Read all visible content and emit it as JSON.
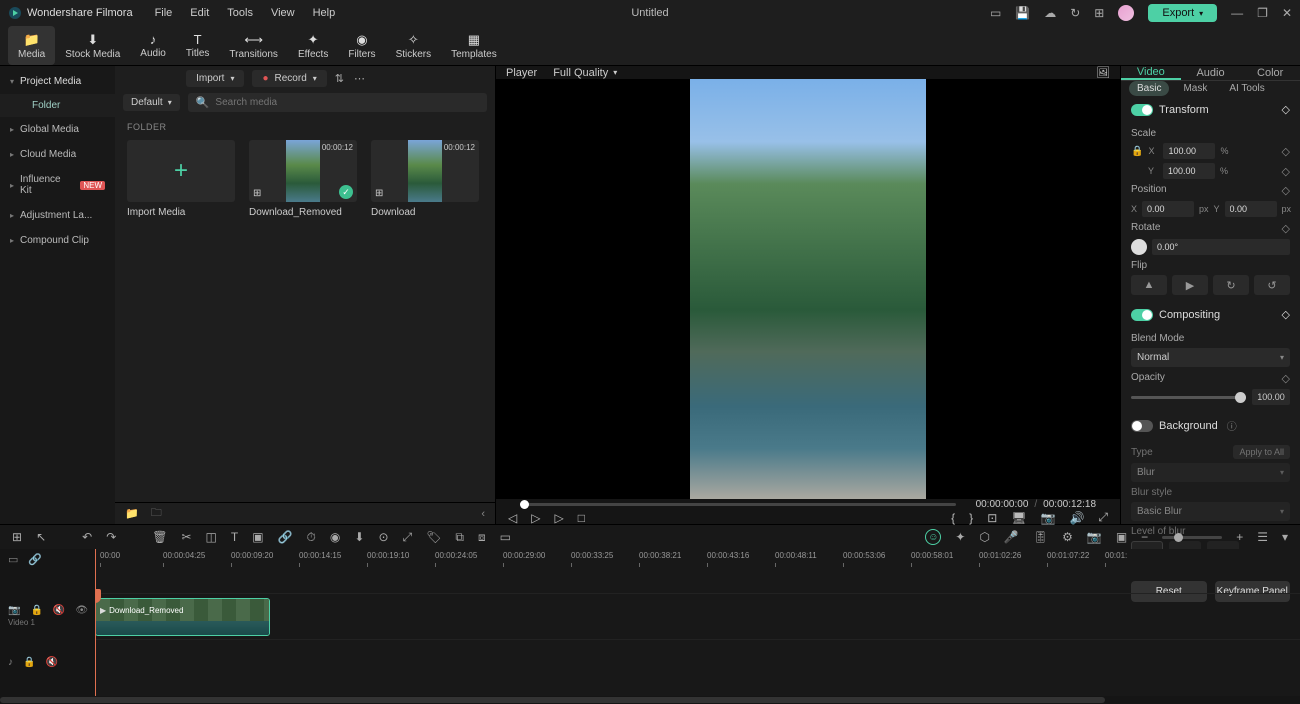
{
  "app": {
    "name": "Wondershare Filmora",
    "doc": "Untitled"
  },
  "menu": [
    "File",
    "Edit",
    "Tools",
    "View",
    "Help"
  ],
  "export": "Export",
  "ribbon": [
    {
      "label": "Media",
      "active": true
    },
    {
      "label": "Stock Media"
    },
    {
      "label": "Audio"
    },
    {
      "label": "Titles"
    },
    {
      "label": "Transitions"
    },
    {
      "label": "Effects"
    },
    {
      "label": "Filters"
    },
    {
      "label": "Stickers"
    },
    {
      "label": "Templates"
    }
  ],
  "leftTop": {
    "import": "Import",
    "record": "Record"
  },
  "sidebar": {
    "project": "Project Media",
    "folder": "Folder",
    "items": [
      {
        "label": "Global Media"
      },
      {
        "label": "Cloud Media"
      },
      {
        "label": "Influence Kit",
        "badge": "NEW"
      },
      {
        "label": "Adjustment La..."
      },
      {
        "label": "Compound Clip"
      }
    ]
  },
  "content": {
    "default": "Default",
    "searchPlaceholder": "Search media",
    "folderLabel": "FOLDER",
    "media": [
      {
        "name": "Import Media",
        "kind": "import"
      },
      {
        "name": "Download_Removed",
        "duration": "00:00:12",
        "checked": true
      },
      {
        "name": "Download",
        "duration": "00:00:12"
      }
    ]
  },
  "player": {
    "label": "Player",
    "quality": "Full Quality",
    "current": "00:00:00:00",
    "total": "00:00:12:18"
  },
  "right": {
    "tabs": [
      "Video",
      "Audio",
      "Color"
    ],
    "subtabs": [
      "Basic",
      "Mask",
      "AI Tools"
    ],
    "transform": "Transform",
    "scale": "Scale",
    "scaleX": "100.00",
    "scaleY": "100.00",
    "position": "Position",
    "posX": "0.00",
    "posY": "0.00",
    "rotate": "Rotate",
    "rotateVal": "0.00°",
    "flip": "Flip",
    "compositing": "Compositing",
    "blendMode": "Blend Mode",
    "blendVal": "Normal",
    "opacity": "Opacity",
    "opacityVal": "100.00",
    "background": "Background",
    "type": "Type",
    "typeVal": "Blur",
    "applyAll": "Apply to All",
    "blurStyle": "Blur style",
    "blurStyleVal": "Basic Blur",
    "levelBlur": "Level of blur",
    "reset": "Reset",
    "keyframePanel": "Keyframe Panel"
  },
  "timeline": {
    "ticks": [
      "00:00",
      "00:00:04:25",
      "00:00:09:20",
      "00:00:14:15",
      "00:00:19:10",
      "00:00:24:05",
      "00:00:29:00",
      "00:00:33:25",
      "00:00:38:21",
      "00:00:43:16",
      "00:00:48:11",
      "00:00:53:06",
      "00:00:58:01",
      "00:01:02:26",
      "00:01:07:22",
      "00:01:"
    ],
    "videoTrack": "Video 1",
    "clipName": "Download_Removed"
  }
}
